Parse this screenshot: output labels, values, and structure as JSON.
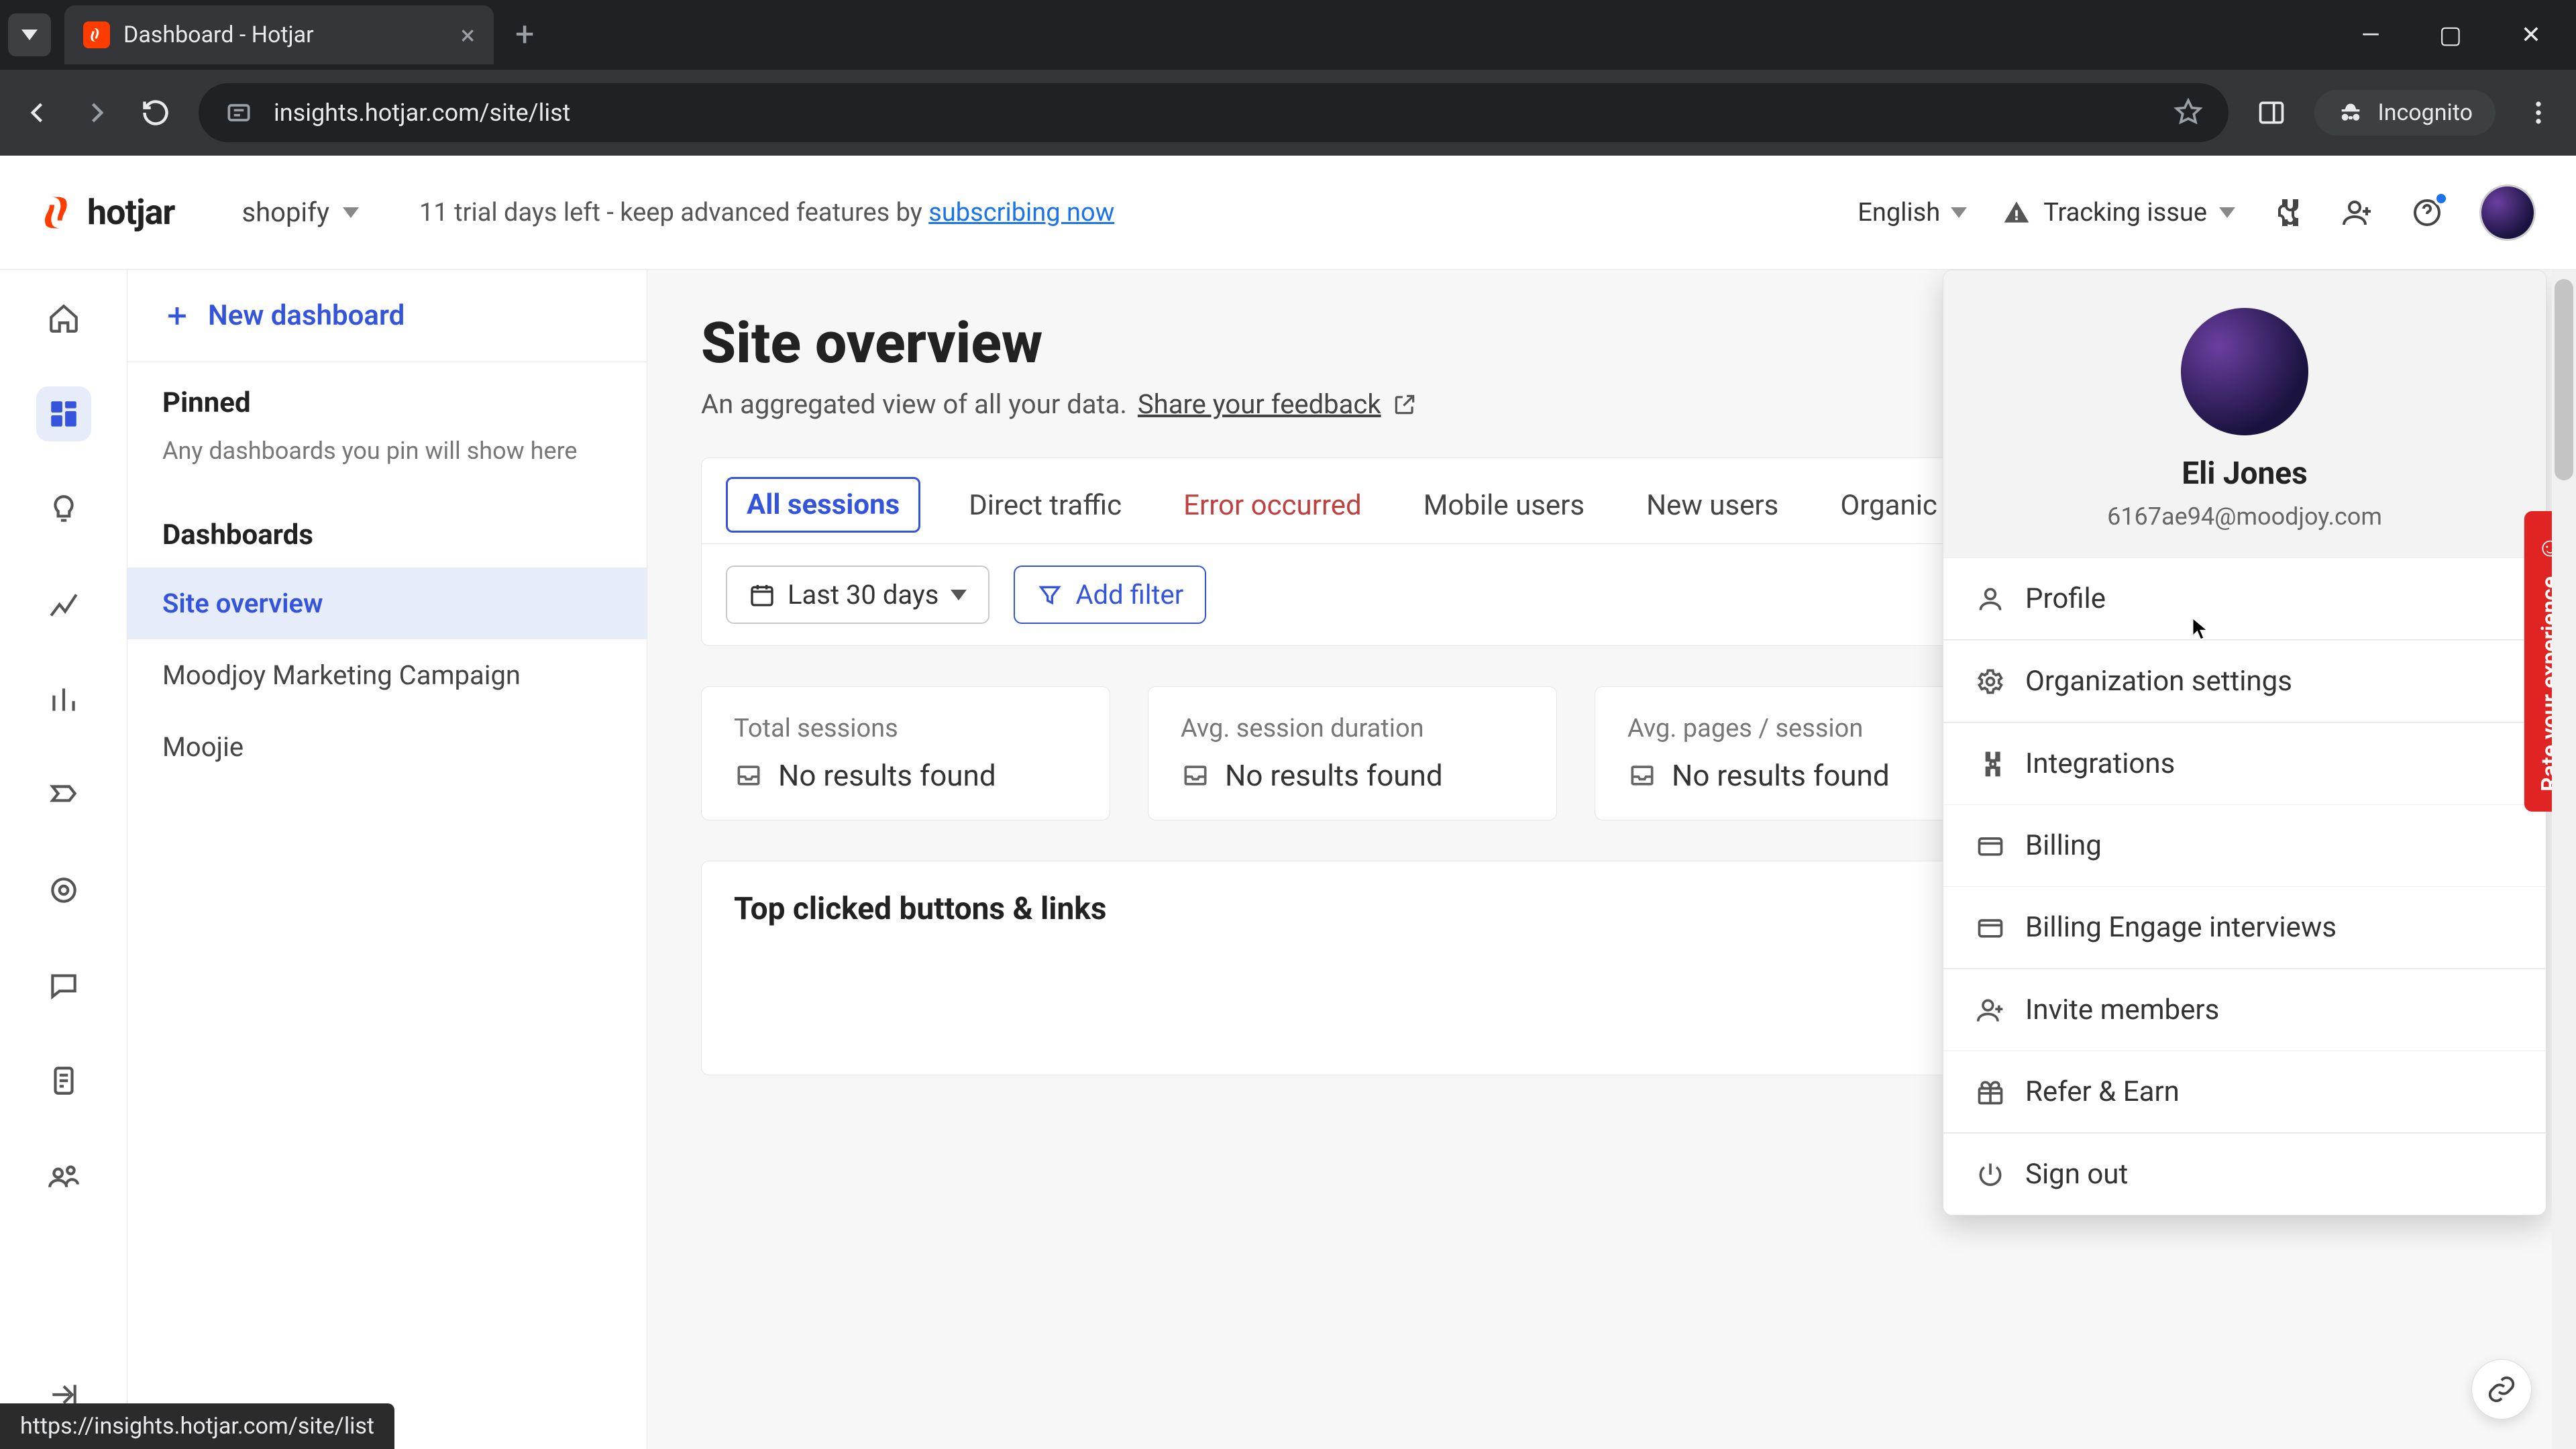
{
  "browser": {
    "tab_title": "Dashboard - Hotjar",
    "url": "insights.hotjar.com/site/list",
    "incognito_label": "Incognito",
    "status_url": "https://insights.hotjar.com/site/list"
  },
  "header": {
    "logo_text": "hotjar",
    "site_name": "shopify",
    "trial_prefix": "11 trial days left - keep advanced features by ",
    "trial_link": "subscribing now",
    "language": "English",
    "tracking_label": "Tracking issue"
  },
  "sidebar": {
    "new_dashboard": "New dashboard",
    "pinned_heading": "Pinned",
    "pinned_hint": "Any dashboards you pin will show here",
    "dashboards_heading": "Dashboards",
    "items": [
      {
        "label": "Site overview",
        "active": true
      },
      {
        "label": "Moodjoy Marketing Campaign",
        "active": false
      },
      {
        "label": "Moojie",
        "active": false
      }
    ]
  },
  "main": {
    "title": "Site overview",
    "subtitle_prefix": "An aggregated view of all your data. ",
    "subtitle_link": "Share your feedback",
    "tabs": [
      {
        "label": "All sessions",
        "state": "active"
      },
      {
        "label": "Direct traffic",
        "state": "normal"
      },
      {
        "label": "Error occurred",
        "state": "error"
      },
      {
        "label": "Mobile users",
        "state": "normal"
      },
      {
        "label": "New users",
        "state": "normal"
      },
      {
        "label": "Organic tra",
        "state": "normal"
      }
    ],
    "date_label": "Last 30 days",
    "add_filter": "Add filter",
    "metrics": [
      {
        "label": "Total sessions",
        "value": "No results found"
      },
      {
        "label": "Avg. session duration",
        "value": "No results found"
      },
      {
        "label": "Avg. pages / session",
        "value": "No results found"
      }
    ],
    "section_title": "Top clicked buttons & links"
  },
  "account_menu": {
    "name": "Eli Jones",
    "email": "6167ae94@moodjoy.com",
    "items": {
      "profile": "Profile",
      "org": "Organization settings",
      "integrations": "Integrations",
      "billing": "Billing",
      "billing_engage": "Billing Engage interviews",
      "invite": "Invite members",
      "refer": "Refer & Earn",
      "signout": "Sign out"
    }
  },
  "feedback": {
    "label": "Rate your experience"
  }
}
